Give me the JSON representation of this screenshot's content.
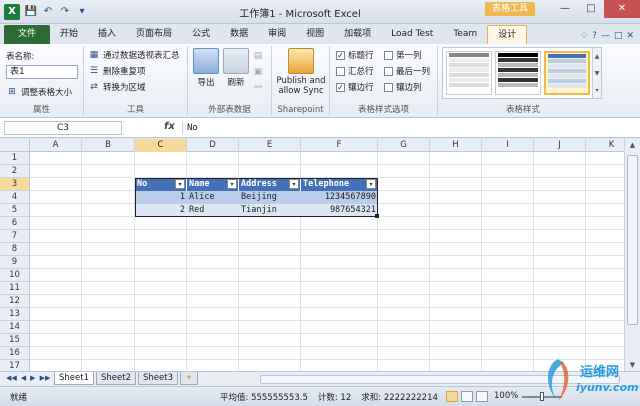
{
  "window": {
    "title": "工作簿1 - Microsoft Excel",
    "context_tab": "表格工具",
    "app_icon": "X",
    "buttons": [
      "—",
      "□",
      "✕"
    ]
  },
  "qat": {
    "save": "💾",
    "undo": "↶",
    "redo": "↷",
    "customize": "▾"
  },
  "tabs": {
    "file": "文件",
    "items": [
      "开始",
      "插入",
      "页面布局",
      "公式",
      "数据",
      "审阅",
      "视图",
      "加载项",
      "Load Test",
      "Team"
    ],
    "design": "设计",
    "right_icons": [
      "♢",
      "?",
      "—",
      "□",
      "✕"
    ]
  },
  "ribbon": {
    "properties": {
      "name_label": "表名称:",
      "name_value": "表1",
      "resize_label": "调整表格大小",
      "group_label": "属性"
    },
    "tools": {
      "items": [
        "通过数据透视表汇总",
        "删除重复项",
        "转换为区域"
      ],
      "group_label": "工具"
    },
    "external": {
      "export": "导出",
      "refresh": "刷新",
      "group_label": "外部表数据"
    },
    "sharepoint": {
      "label": "Publish and allow Sync",
      "label_line1": "Publish and",
      "label_line2": "allow Sync",
      "group_label": "Sharepoint"
    },
    "style_options": {
      "col1": [
        {
          "label": "标题行",
          "checked": true
        },
        {
          "label": "汇总行",
          "checked": false
        },
        {
          "label": "镶边行",
          "checked": true
        }
      ],
      "col2": [
        {
          "label": "第一列",
          "checked": false
        },
        {
          "label": "最后一列",
          "checked": false
        },
        {
          "label": "镶边列",
          "checked": false
        }
      ],
      "group_label": "表格样式选项"
    },
    "table_styles": {
      "group_label": "表格样式"
    }
  },
  "formula_bar": {
    "name_box": "C3",
    "fx": "fx",
    "value": "No"
  },
  "grid": {
    "columns": [
      "A",
      "B",
      "C",
      "D",
      "E",
      "F",
      "G",
      "H",
      "I",
      "J",
      "K"
    ],
    "rows": [
      "1",
      "2",
      "3",
      "4",
      "5",
      "6",
      "7",
      "8",
      "9",
      "10",
      "11",
      "12",
      "13",
      "14",
      "15",
      "16",
      "17"
    ],
    "table": {
      "headers": [
        "No",
        "Name",
        "Address",
        "Telephone"
      ],
      "rows": [
        [
          "1",
          "Alice",
          "Beijing",
          "1234567890"
        ],
        [
          "2",
          "Red",
          "Tianjin",
          "987654321"
        ]
      ]
    }
  },
  "sheets": {
    "nav": [
      "◀◀",
      "◀",
      "▶",
      "▶▶"
    ],
    "tabs": [
      "Sheet1",
      "Sheet2",
      "Sheet3"
    ],
    "active": "Sheet1"
  },
  "status": {
    "ready": "就绪",
    "average": "平均值: 555555553.5",
    "count": "计数: 12",
    "sum": "求和: 2222222214",
    "zoom": "100%"
  },
  "watermark": {
    "line1": "运维网",
    "line2": "iyunv.com"
  },
  "colors": {
    "file_tab": "#2d6b35",
    "table_header": "#4470b8",
    "band_dark": "#b8cdea",
    "band_light": "#dce6f4",
    "selection": "#f9d99a"
  }
}
